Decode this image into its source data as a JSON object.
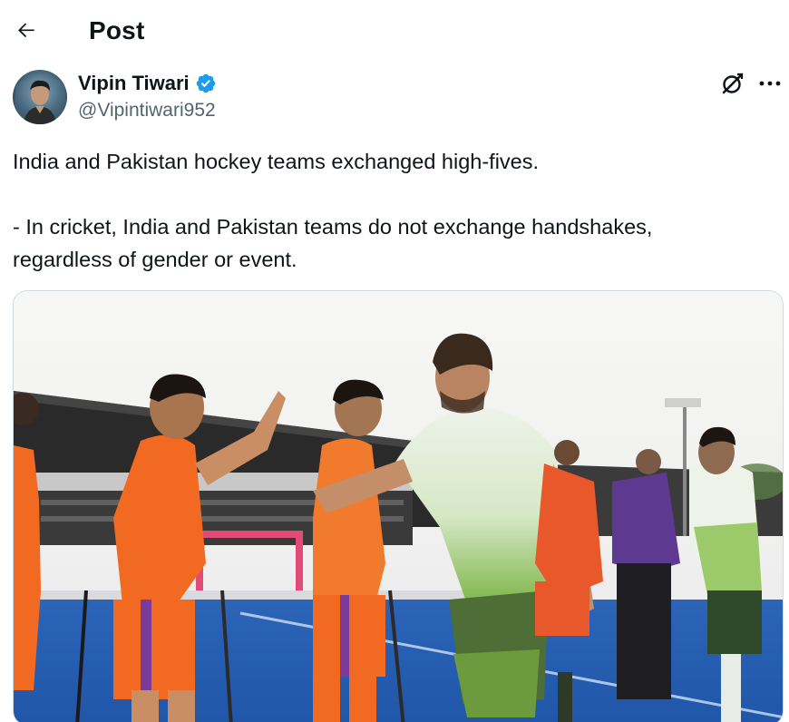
{
  "header": {
    "title": "Post"
  },
  "author": {
    "name": "Vipin Tiwari",
    "handle": "@Vipintiwari952",
    "verified": true,
    "verified_color": "#1d9bf0"
  },
  "post": {
    "paragraphs": [
      "India and Pakistan hockey teams exchanged high-fives.",
      "- In cricket, India and Pakistan teams do not exchange handshakes,",
      "regardless of gender or event."
    ]
  },
  "media": {
    "icon": "photo",
    "colors": {
      "india_jersey": "#f26a21",
      "pakistan_jersey": "#e9f1e6",
      "pakistan_green": "#6fae3a",
      "turf": "#2a6ed1",
      "sky": "#f4f4f2"
    }
  },
  "icons": {
    "back": "arrow-left-icon",
    "verified": "verified-badge-icon",
    "grok": "grok-icon",
    "more": "more-horizontal-icon"
  }
}
